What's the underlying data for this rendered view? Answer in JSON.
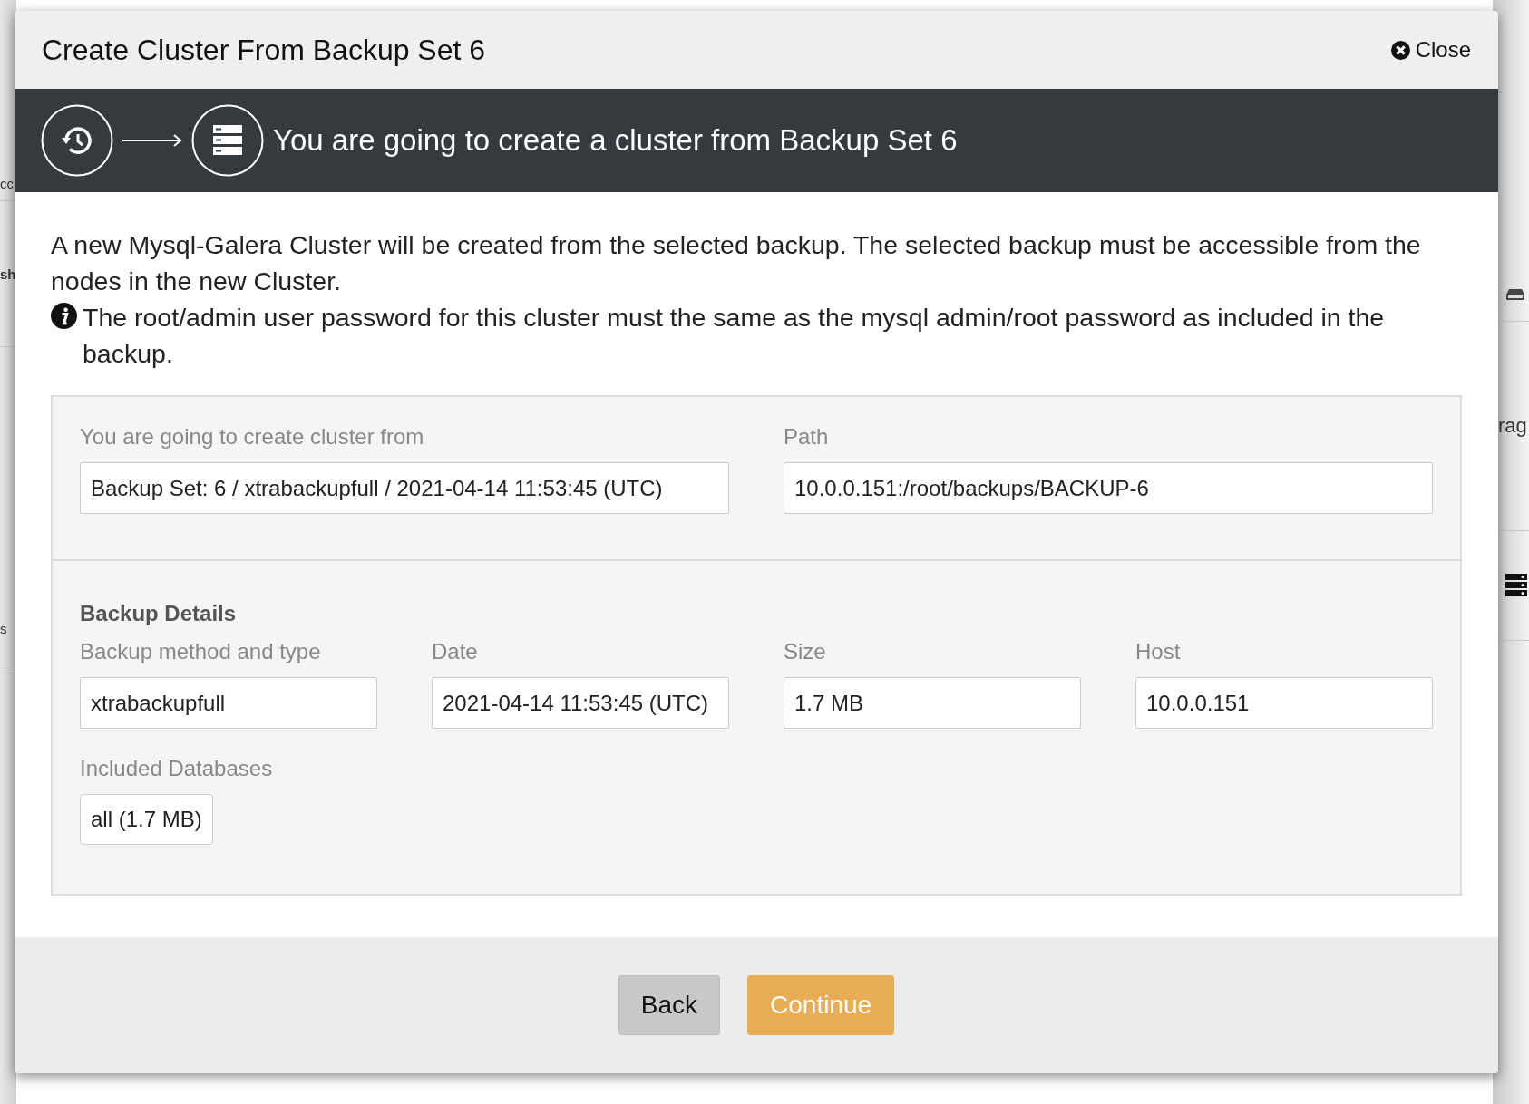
{
  "background": {
    "left_texts": [
      "cc",
      "sh",
      "s"
    ],
    "right_texts": [
      "rag"
    ]
  },
  "dialog": {
    "title": "Create Cluster From Backup Set 6",
    "close_label": "Close"
  },
  "banner": {
    "text": "You are going to create a cluster from Backup Set 6"
  },
  "intro": "A new Mysql-Galera Cluster will be created from the selected backup. The selected backup must be accessible from the nodes in the new Cluster.",
  "note": "The root/admin user password for this cluster must the same as the mysql admin/root password as included in the backup.",
  "source": {
    "fields": [
      {
        "label": "You are going to create cluster from",
        "value": "Backup Set: 6 / xtrabackupfull / 2021-04-14 11:53:45 (UTC)"
      },
      {
        "label": "Path",
        "value": "10.0.0.151:/root/backups/BACKUP-6"
      }
    ]
  },
  "details": {
    "heading": "Backup Details",
    "fields": [
      {
        "label": "Backup method and type",
        "value": "xtrabackupfull"
      },
      {
        "label": "Date",
        "value": "2021-04-14 11:53:45 (UTC)"
      },
      {
        "label": "Size",
        "value": "1.7 MB"
      },
      {
        "label": "Host",
        "value": "10.0.0.151"
      }
    ],
    "databases_label": "Included Databases",
    "databases": [
      "all (1.7 MB)"
    ]
  },
  "buttons": [
    {
      "label": "Back",
      "kind": "secondary"
    },
    {
      "label": "Continue",
      "kind": "primary"
    }
  ]
}
